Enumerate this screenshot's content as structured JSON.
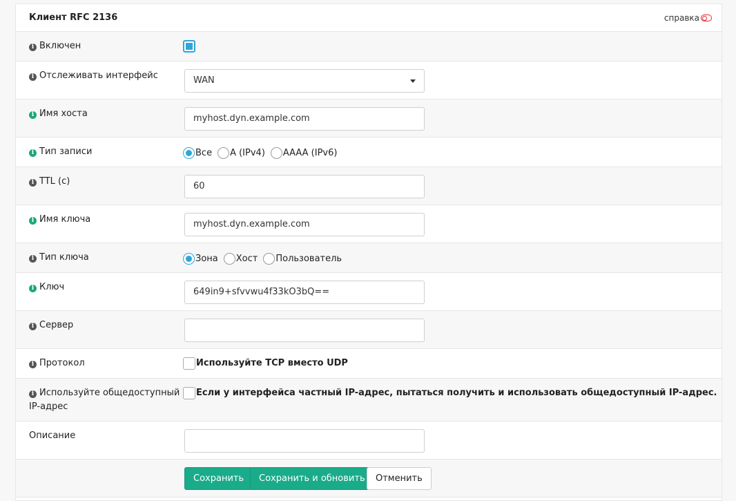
{
  "header": {
    "title": "Клиент RFC 2136",
    "help_label": "справка"
  },
  "fields": {
    "enabled": {
      "label": "Включен",
      "checked": true
    },
    "interface": {
      "label": "Отслеживать интерфейс",
      "value": "WAN"
    },
    "hostname": {
      "label": "Имя хоста",
      "value": "myhost.dyn.example.com"
    },
    "record_type": {
      "label": "Тип записи",
      "options": [
        "Все",
        "A (IPv4)",
        "AAAA (IPv6)"
      ],
      "selected": "Все"
    },
    "ttl": {
      "label": "TTL (с)",
      "value": "60"
    },
    "key_name": {
      "label": "Имя ключа",
      "value": "myhost.dyn.example.com"
    },
    "key_type": {
      "label": "Тип ключа",
      "options": [
        "Зона",
        "Хост",
        "Пользователь"
      ],
      "selected": "Зона"
    },
    "key": {
      "label": "Ключ",
      "value": "649in9+sfvvwu4f33kO3bQ=="
    },
    "server": {
      "label": "Сервер",
      "value": ""
    },
    "protocol": {
      "label": "Протокол",
      "checkbox_label": "Используйте TCP вместо UDP",
      "checked": false
    },
    "public_ip": {
      "label_line1": "Используйте общедоступный",
      "label_line2": "IP-адрес",
      "checkbox_label": "Если у интерфейса частный IP-адрес, пытаться получить и использовать общедоступный IP-адрес.",
      "checked": false
    },
    "description": {
      "label": "Описание",
      "value": ""
    }
  },
  "buttons": {
    "save": "Сохранить",
    "save_update": "Сохранить и обновить",
    "cancel": "Отменить"
  },
  "colors": {
    "accent": "#2ea6d8",
    "button": "#1aab8a",
    "info_green": "#1aa77d",
    "toggle_red": "#e0282d"
  }
}
